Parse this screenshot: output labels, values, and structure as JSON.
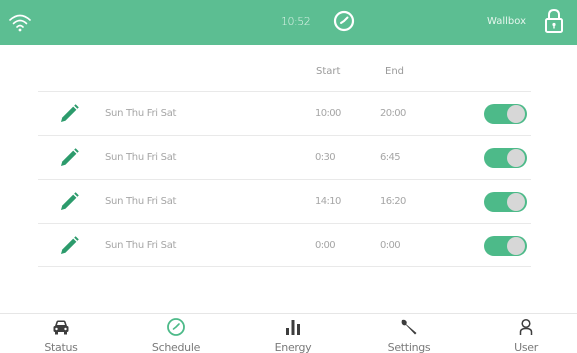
{
  "colors": {
    "accent": "#5cbe92",
    "toggle_on": "#4dba89",
    "pencil": "#2c9b6c"
  },
  "header": {
    "time": "10:52",
    "device_name": "Wallbox",
    "icons": {
      "wifi": "wifi-icon",
      "clock": "clock-icon",
      "lock": "lock-icon"
    }
  },
  "table": {
    "columns": {
      "start": "Start",
      "end": "End"
    },
    "rows": [
      {
        "days": "Sun Thu Fri Sat",
        "start": "10:00",
        "end": "20:00",
        "enabled": true
      },
      {
        "days": "Sun Thu Fri Sat",
        "start": "0:30",
        "end": "6:45",
        "enabled": true
      },
      {
        "days": "Sun Thu Fri Sat",
        "start": "14:10",
        "end": "16:20",
        "enabled": true
      },
      {
        "days": "Sun Thu Fri Sat",
        "start": "0:00",
        "end": "0:00",
        "enabled": true
      }
    ]
  },
  "nav": {
    "active": "schedule",
    "items": [
      {
        "label": "Status",
        "icon": "car-icon"
      },
      {
        "label": "Schedule",
        "icon": "clock-icon"
      },
      {
        "label": "Energy",
        "icon": "bar-chart-icon"
      },
      {
        "label": "Settings",
        "icon": "wrench-icon"
      },
      {
        "label": "User",
        "icon": "user-icon"
      }
    ]
  }
}
